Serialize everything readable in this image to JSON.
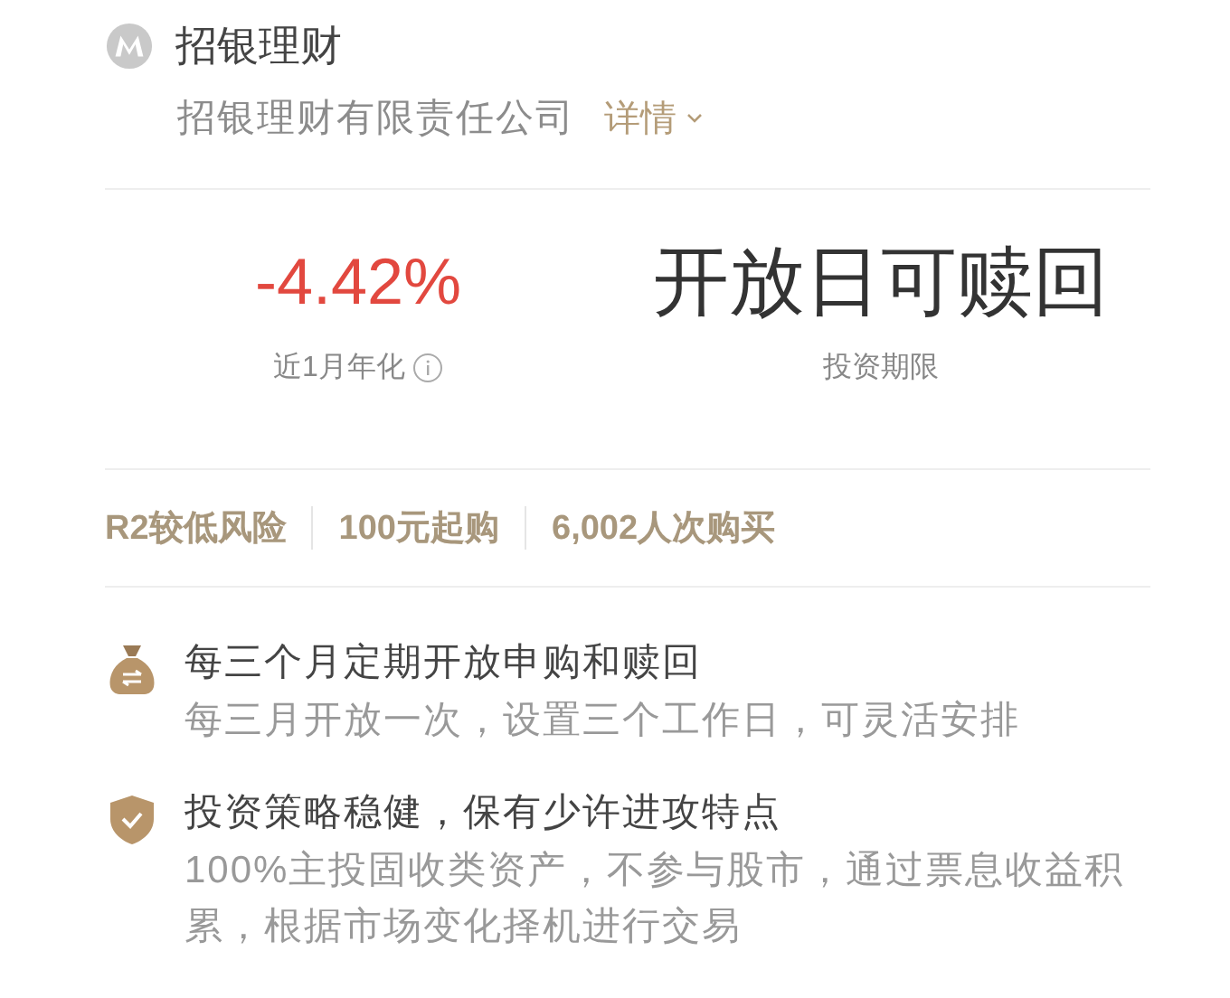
{
  "header": {
    "title": "招银理财",
    "company": "招银理财有限责任公司",
    "details_link": "详情"
  },
  "stats": [
    {
      "kind": "rate",
      "value": "-4.42%",
      "label": "近1月年化",
      "info_icon": true
    },
    {
      "kind": "term",
      "value": "开放日可赎回",
      "label": "投资期限",
      "info_icon": false
    }
  ],
  "tags": [
    "R2较低风险",
    "100元起购",
    "6,002人次购买"
  ],
  "features": [
    {
      "kind": "money-bag",
      "title": "每三个月定期开放申购和赎回",
      "description": "每三月开放一次，设置三个工作日，可灵活安排"
    },
    {
      "kind": "shield",
      "title": "投资策略稳健，保有少许进攻特点",
      "description": "100%主投固收类资产，不参与股市，通过票息收益积累，根据市场变化择机进行交易"
    }
  ]
}
